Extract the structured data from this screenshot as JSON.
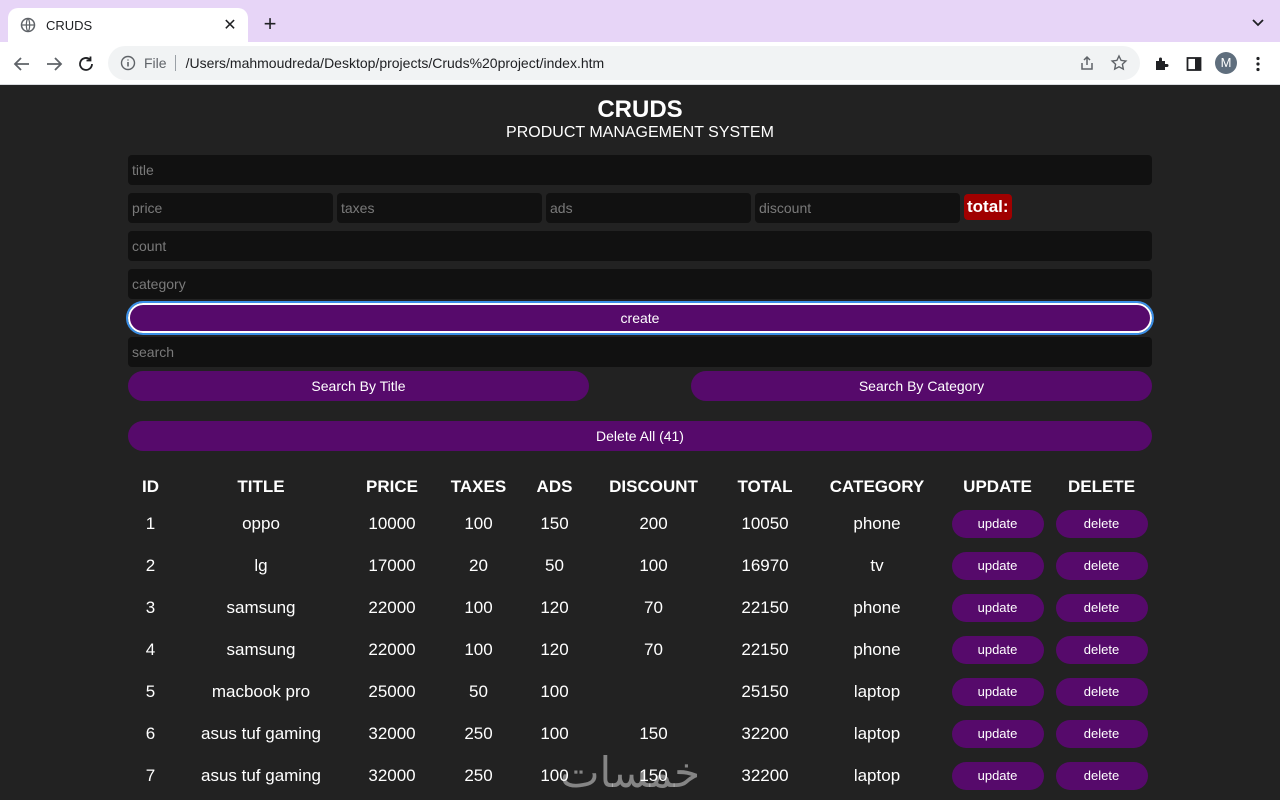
{
  "browser": {
    "tab_title": "CRUDS",
    "scheme_label": "File",
    "url": "/Users/mahmoudreda/Desktop/projects/Cruds%20project/index.htm",
    "profile_initial": "M"
  },
  "app": {
    "title": "CRUDS",
    "subtitle": "PRODUCT MANAGEMENT SYSTEM"
  },
  "form": {
    "title_placeholder": "title",
    "price_placeholder": "price",
    "taxes_placeholder": "taxes",
    "ads_placeholder": "ads",
    "discount_placeholder": "discount",
    "total_label": "total:",
    "count_placeholder": "count",
    "category_placeholder": "category",
    "create_label": "create",
    "search_placeholder": "search",
    "search_title_label": "Search By Title",
    "search_category_label": "Search By Category",
    "delete_all_label": "Delete All (41)"
  },
  "table": {
    "headers": [
      "ID",
      "TITLE",
      "PRICE",
      "TAXES",
      "ADS",
      "DISCOUNT",
      "TOTAL",
      "CATEGORY",
      "UPDATE",
      "DELETE"
    ],
    "update_label": "update",
    "delete_label": "delete",
    "rows": [
      {
        "id": "1",
        "title": "oppo",
        "price": "10000",
        "taxes": "100",
        "ads": "150",
        "discount": "200",
        "total": "10050",
        "category": "phone"
      },
      {
        "id": "2",
        "title": "lg",
        "price": "17000",
        "taxes": "20",
        "ads": "50",
        "discount": "100",
        "total": "16970",
        "category": "tv"
      },
      {
        "id": "3",
        "title": "samsung",
        "price": "22000",
        "taxes": "100",
        "ads": "120",
        "discount": "70",
        "total": "22150",
        "category": "phone"
      },
      {
        "id": "4",
        "title": "samsung",
        "price": "22000",
        "taxes": "100",
        "ads": "120",
        "discount": "70",
        "total": "22150",
        "category": "phone"
      },
      {
        "id": "5",
        "title": "macbook pro",
        "price": "25000",
        "taxes": "50",
        "ads": "100",
        "discount": "",
        "total": "25150",
        "category": "laptop"
      },
      {
        "id": "6",
        "title": "asus tuf gaming",
        "price": "32000",
        "taxes": "250",
        "ads": "100",
        "discount": "150",
        "total": "32200",
        "category": "laptop"
      },
      {
        "id": "7",
        "title": "asus tuf gaming",
        "price": "32000",
        "taxes": "250",
        "ads": "100",
        "discount": "150",
        "total": "32200",
        "category": "laptop"
      }
    ]
  },
  "watermark": "خمسات",
  "colors": {
    "accent": "#560a6b",
    "total_badge": "#a00000",
    "page_background": "#222222",
    "input_background": "#111111"
  }
}
